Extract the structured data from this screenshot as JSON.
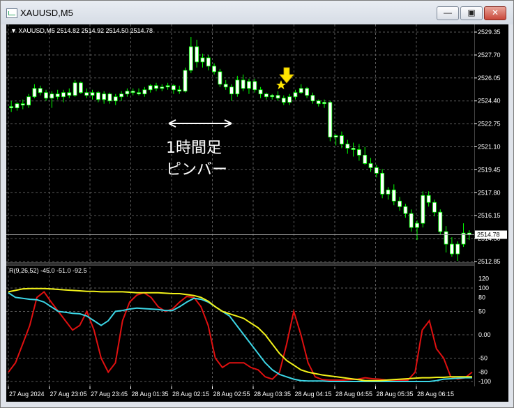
{
  "window": {
    "title": "XAUUSD,M5",
    "buttons": [
      "minimize",
      "maximize",
      "close"
    ]
  },
  "price_pane": {
    "header": "XAUUSD,M5  2514.82 2514.92 2514.50 2514.78",
    "current_price": "2514.78",
    "annotation_line1": "1時間足",
    "annotation_line2": "ピンバー",
    "price_ticks": [
      "2529.35",
      "2527.70",
      "2526.05",
      "2524.40",
      "2522.75",
      "2521.10",
      "2519.45",
      "2517.80",
      "2516.15",
      "2514.50",
      "2512.85"
    ]
  },
  "indicator_pane": {
    "header": "R(9,26,52) -45.0 -51.0 -92.5",
    "ticks": [
      "120",
      "100",
      "80",
      "50",
      "0.00",
      "-50",
      "-80",
      "-100"
    ]
  },
  "time_axis": [
    "27 Aug 2024",
    "27 Aug 23:05",
    "27 Aug 23:45",
    "28 Aug 01:35",
    "28 Aug 02:15",
    "28 Aug 02:55",
    "28 Aug 03:35",
    "28 Aug 04:15",
    "28 Aug 04:55",
    "28 Aug 05:35",
    "28 Aug 06:15"
  ],
  "colors": {
    "bull": "#ffffff",
    "bear": "#ffffff",
    "candle_line": "#00ff00",
    "red": "#e01010",
    "cyan": "#3cd6e6",
    "yellow": "#f2f21a",
    "arrow": "#ffe600"
  }
}
